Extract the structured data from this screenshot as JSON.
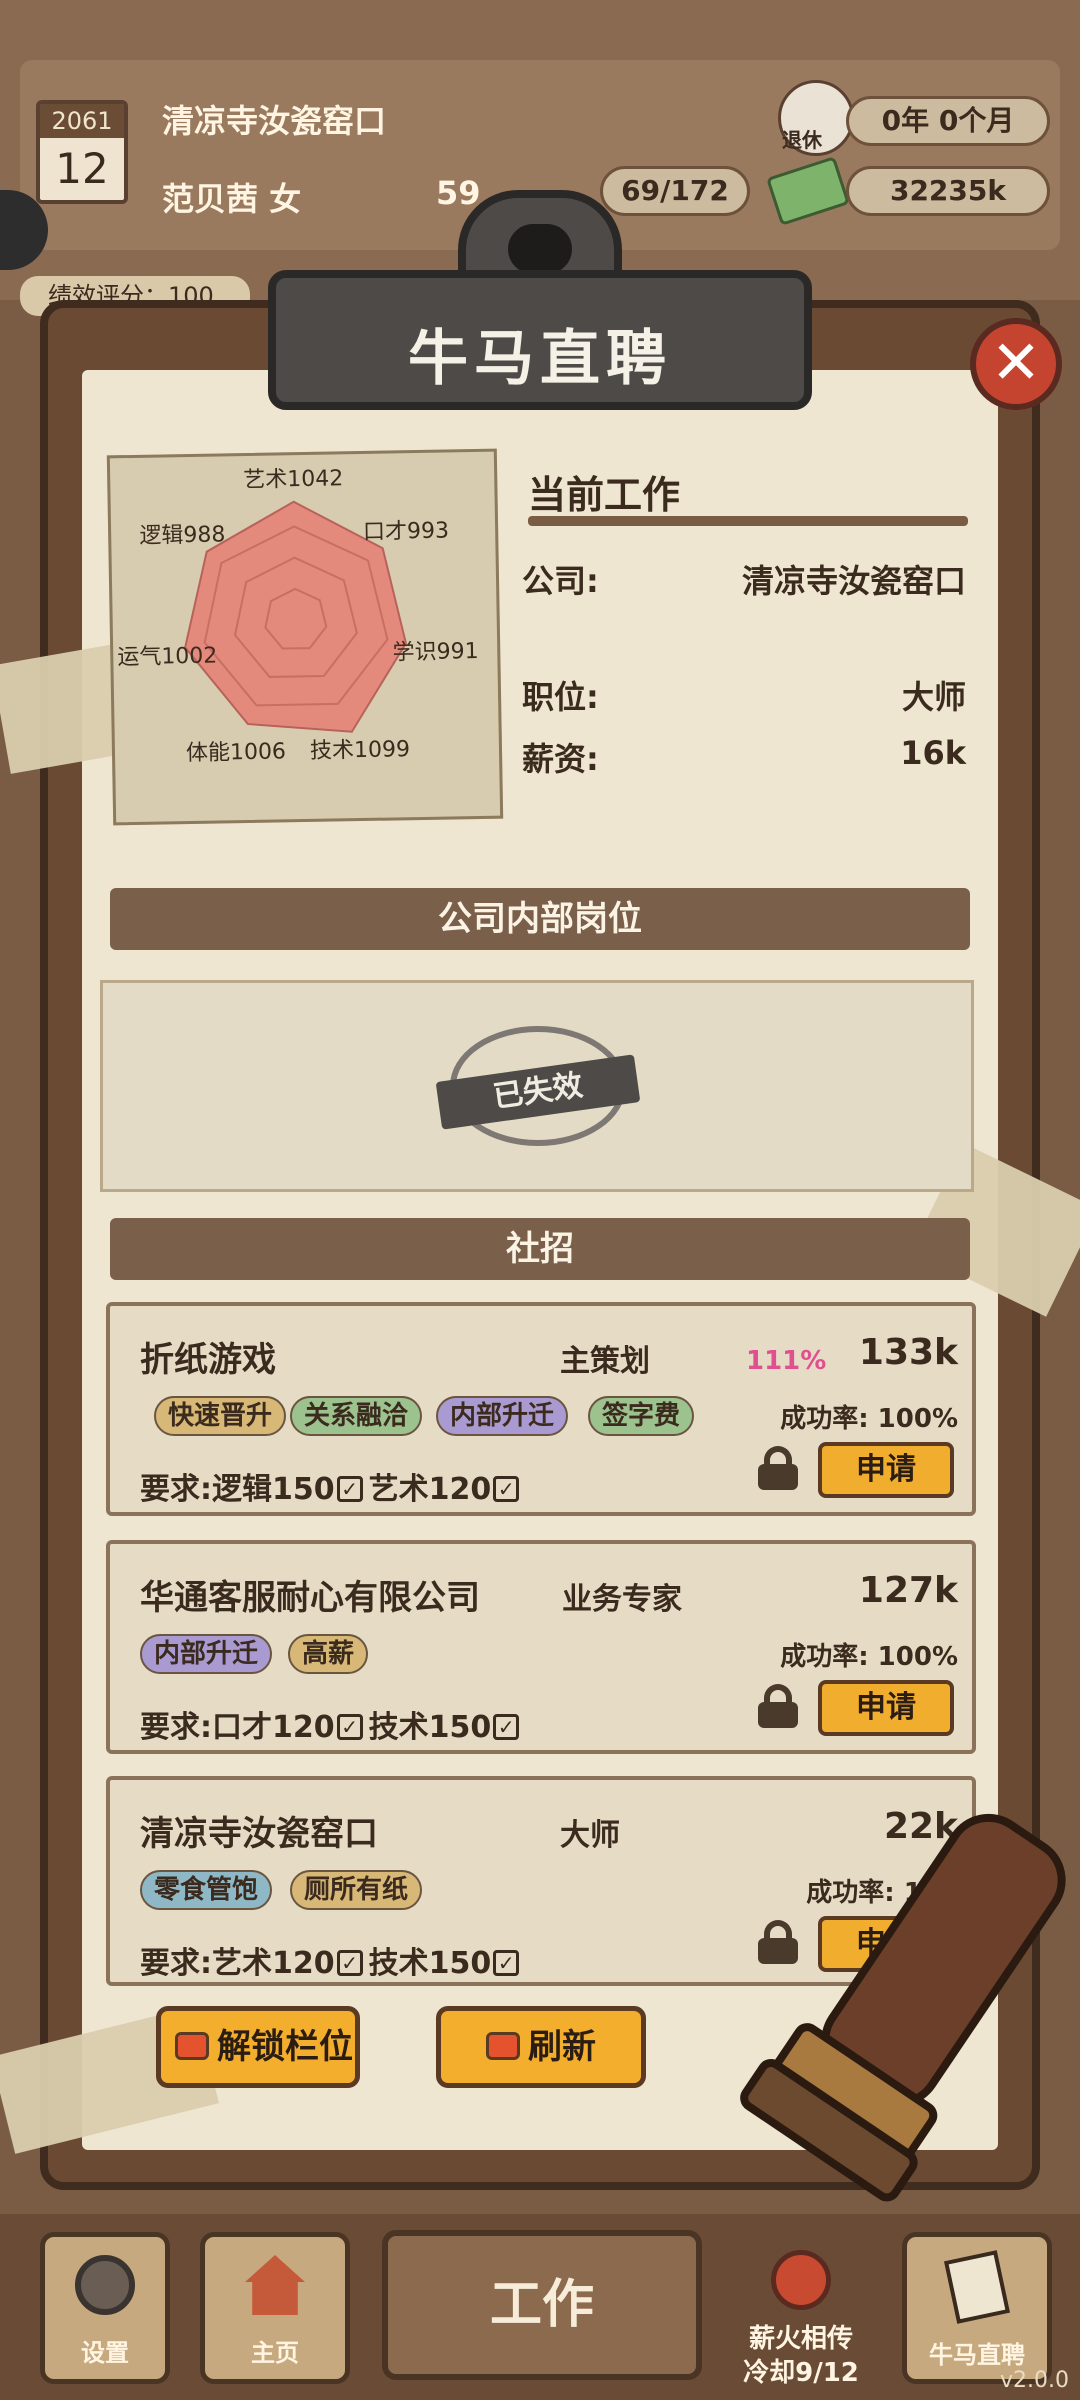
{
  "hud": {
    "calendar_year": "2061",
    "calendar_month": "12",
    "company": "清凉寺汝瓷窑口",
    "name": "范贝茜 女",
    "stat_left": "59",
    "stat_fraction": "69/172",
    "retire_label": "退休",
    "retire_years": "0年",
    "retire_months": "0个月",
    "money": "32235k",
    "score_label": "绩效评分：100"
  },
  "panel": {
    "title": "牛马直聘",
    "close": "✕"
  },
  "radar": {
    "stats": [
      {
        "label": "艺术1042",
        "value": 1042
      },
      {
        "label": "口才993",
        "value": 993
      },
      {
        "label": "学识991",
        "value": 991
      },
      {
        "label": "技术1099",
        "value": 1099
      },
      {
        "label": "体能1006",
        "value": 1006
      },
      {
        "label": "运气1002",
        "value": 1002
      },
      {
        "label": "逻辑988",
        "value": 988
      }
    ],
    "fill_color": "#e48a7c"
  },
  "current_job": {
    "heading": "当前工作",
    "company_label": "公司:",
    "company_value": "清凉寺汝瓷窑口",
    "position_label": "职位:",
    "position_value": "大师",
    "salary_label": "薪资:",
    "salary_value": "16k"
  },
  "internal": {
    "heading": "公司内部岗位",
    "stamp": "已失效"
  },
  "social": {
    "heading": "社招",
    "jobs": [
      {
        "company": "折纸游戏",
        "position": "主策划",
        "percent": "111%",
        "salary": "133k",
        "rate": "成功率: 100%",
        "tags": [
          "快速晋升",
          "关系融洽",
          "内部升迁",
          "签字费"
        ],
        "req_label": "要求:",
        "req1": "逻辑150",
        "req2": "艺术120",
        "apply": "申请"
      },
      {
        "company": "华通客服耐心有限公司",
        "position": "业务专家",
        "salary": "127k",
        "rate": "成功率: 100%",
        "tags": [
          "内部升迁",
          "高薪"
        ],
        "req_label": "要求:",
        "req1": "口才120",
        "req2": "技术150",
        "apply": "申请"
      },
      {
        "company": "清凉寺汝瓷窑口",
        "position": "大师",
        "salary": "22k",
        "rate": "成功率: 100",
        "tags": [
          "零食管饱",
          "厕所有纸"
        ],
        "req_label": "要求:",
        "req1": "艺术120",
        "req2": "技术150",
        "apply": "申请"
      }
    ]
  },
  "actions": {
    "unlock": "解锁栏位",
    "refresh": "刷新"
  },
  "nav": {
    "settings": "设置",
    "home": "主页",
    "work": "工作",
    "fire": "薪火相传",
    "cooldown": "冷却9/12",
    "hire": "牛马直聘"
  },
  "version": "v2.0.0",
  "tag_colors": {
    "快速晋升": "#d8b877",
    "关系融洽": "#9cc28e",
    "内部升迁": "#a99ad1",
    "签字费": "#9cc28e",
    "高薪": "#d8b877",
    "零食管饱": "#8fb8c6",
    "厕所有纸": "#d8b877"
  }
}
